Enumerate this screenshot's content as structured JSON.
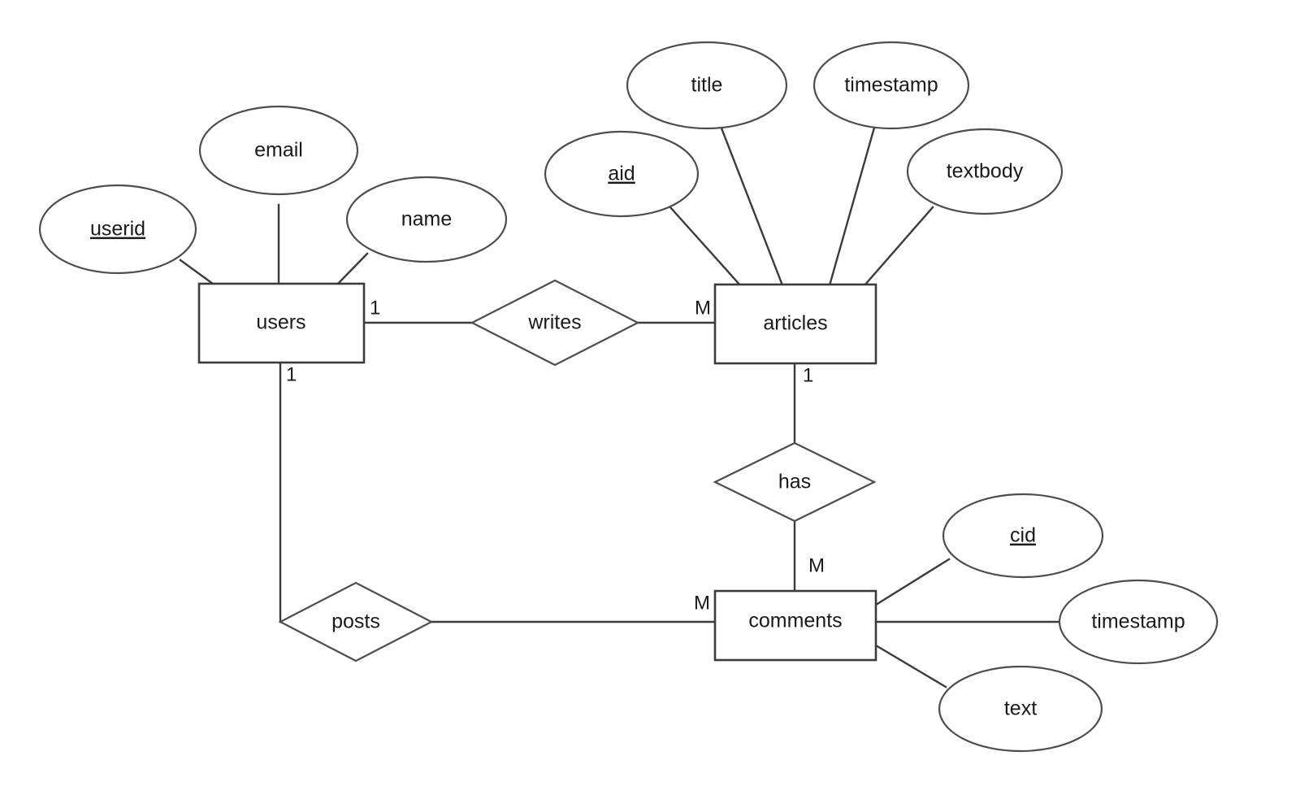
{
  "diagram": {
    "type": "entity-relationship-diagram",
    "background_color": "#ffffff",
    "stroke_color": "#3b3b3b",
    "text_color": "#1a1a1a",
    "entities": [
      {
        "id": "users",
        "label": "users"
      },
      {
        "id": "articles",
        "label": "articles"
      },
      {
        "id": "comments",
        "label": "comments"
      }
    ],
    "relationships": [
      {
        "id": "writes",
        "label": "writes",
        "from": "users",
        "to": "articles",
        "from_cardinality": "1",
        "to_cardinality": "M"
      },
      {
        "id": "has",
        "label": "has",
        "from": "articles",
        "to": "comments",
        "from_cardinality": "1",
        "to_cardinality": "M"
      },
      {
        "id": "posts",
        "label": "posts",
        "from": "users",
        "to": "comments",
        "from_cardinality": "1",
        "to_cardinality": "M"
      }
    ],
    "attributes": [
      {
        "id": "users-userid",
        "label": "userid",
        "entity": "users",
        "primary_key": true
      },
      {
        "id": "users-email",
        "label": "email",
        "entity": "users",
        "primary_key": false
      },
      {
        "id": "users-name",
        "label": "name",
        "entity": "users",
        "primary_key": false
      },
      {
        "id": "articles-aid",
        "label": "aid",
        "entity": "articles",
        "primary_key": true
      },
      {
        "id": "articles-title",
        "label": "title",
        "entity": "articles",
        "primary_key": false
      },
      {
        "id": "articles-timestamp",
        "label": "timestamp",
        "entity": "articles",
        "primary_key": false
      },
      {
        "id": "articles-textbody",
        "label": "textbody",
        "entity": "articles",
        "primary_key": false
      },
      {
        "id": "comments-cid",
        "label": "cid",
        "entity": "comments",
        "primary_key": true
      },
      {
        "id": "comments-timestamp",
        "label": "timestamp",
        "entity": "comments",
        "primary_key": false
      },
      {
        "id": "comments-text",
        "label": "text",
        "entity": "comments",
        "primary_key": false
      }
    ],
    "cardinality_labels": {
      "users_writes": "1",
      "articles_writes": "M",
      "articles_has": "1",
      "comments_has": "M",
      "users_posts": "1",
      "comments_posts": "M"
    }
  }
}
